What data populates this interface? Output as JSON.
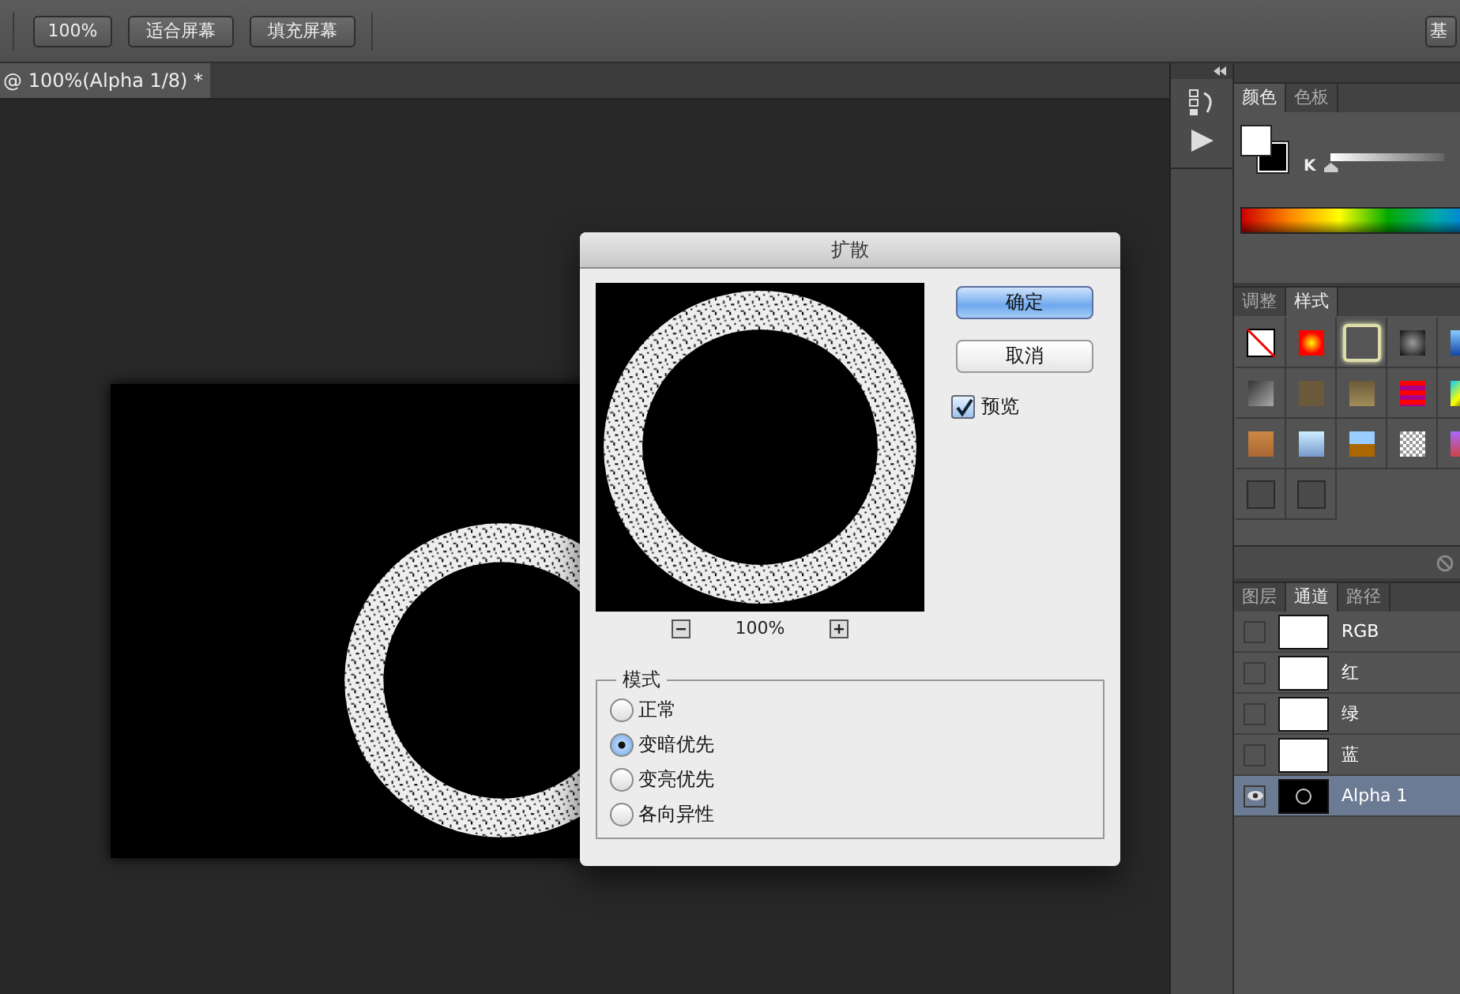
{
  "toolbar": {
    "buttons": [
      "100%",
      "适合屏幕",
      "填充屏幕"
    ],
    "cut_button": "基"
  },
  "document_tab": {
    "label": "@ 100%(Alpha 1/8) *",
    "selected": true
  },
  "color_panel": {
    "tabs": [
      {
        "label": "颜色",
        "selected": true
      },
      {
        "label": "色板",
        "selected": false
      }
    ],
    "slider_label": "K",
    "level": 0
  },
  "styles_panel": {
    "tabs": [
      {
        "label": "调整",
        "selected": false
      },
      {
        "label": "样式",
        "selected": true
      }
    ]
  },
  "channels_panel": {
    "tabs": [
      {
        "label": "图层",
        "selected": false
      },
      {
        "label": "通道",
        "selected": true
      },
      {
        "label": "路径",
        "selected": false
      }
    ],
    "channels": [
      {
        "name": "RGB",
        "kind": "color",
        "visible": false,
        "selected": false
      },
      {
        "name": "红",
        "kind": "color",
        "visible": false,
        "selected": false
      },
      {
        "name": "绿",
        "kind": "color",
        "visible": false,
        "selected": false
      },
      {
        "name": "蓝",
        "kind": "color",
        "visible": false,
        "selected": false
      },
      {
        "name": "Alpha 1",
        "kind": "alpha",
        "visible": true,
        "selected": true
      }
    ]
  },
  "dialog": {
    "title": "扩散",
    "zoom": "100%",
    "buttons": [
      {
        "label": "确定",
        "default": true
      },
      {
        "label": "取消",
        "default": false
      }
    ],
    "preview": {
      "label": "预览",
      "checked": true
    },
    "mode": {
      "legend": "模式",
      "options": [
        {
          "label": "正常",
          "selected": false
        },
        {
          "label": "变暗优先",
          "selected": true
        },
        {
          "label": "变亮优先",
          "selected": false
        },
        {
          "label": "各向异性",
          "selected": false
        }
      ]
    }
  }
}
